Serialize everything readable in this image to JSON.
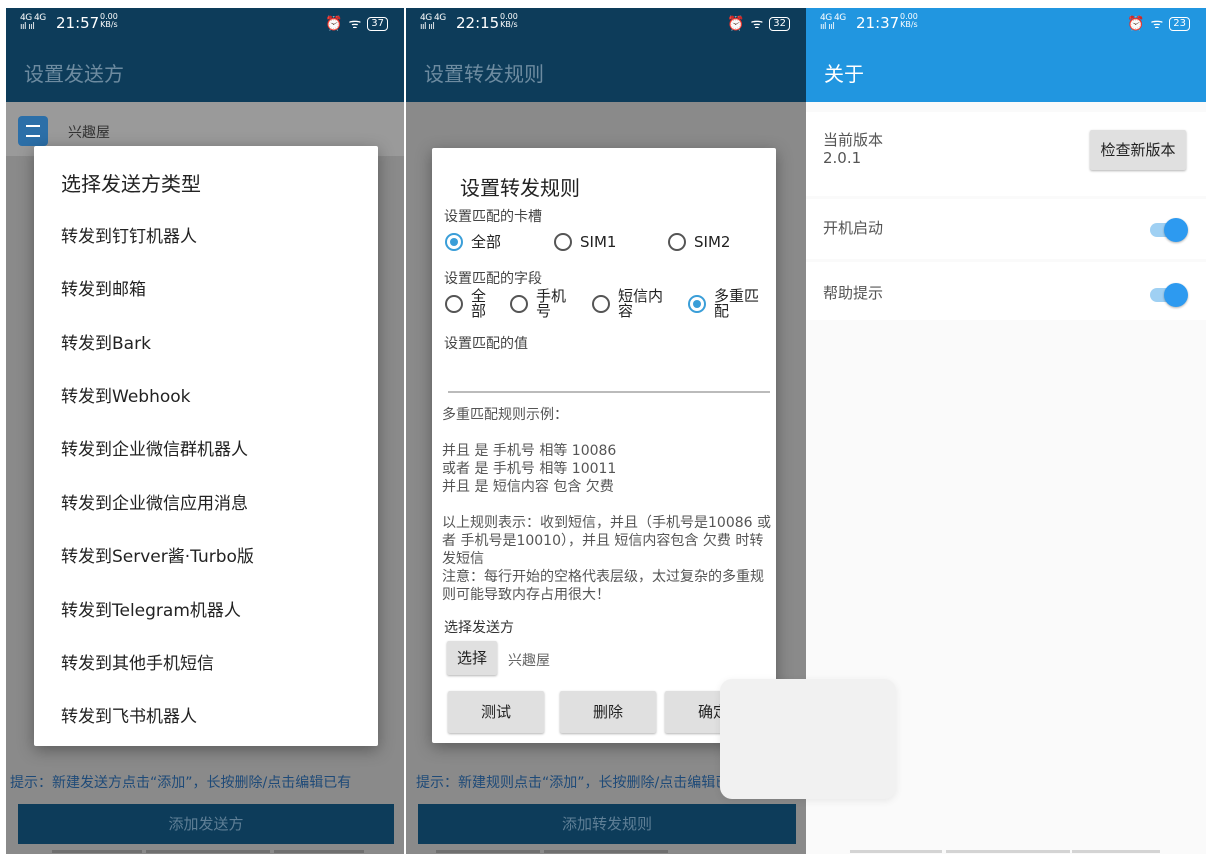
{
  "panel1": {
    "status": {
      "signal": "4G 4G",
      "time": "21:57",
      "speed": "0.00 KB/s",
      "alarm_icon": "alarm-clock-icon",
      "wifi_icon": "wifi-icon",
      "battery": "37"
    },
    "title": "设置发送方",
    "list_item": "兴趣屋",
    "dialog": {
      "title": "选择发送方类型",
      "options": [
        "转发到钉钉机器人",
        "转发到邮箱",
        "转发到Bark",
        "转发到Webhook",
        "转发到企业微信群机器人",
        "转发到企业微信应用消息",
        "转发到Server酱·Turbo版",
        "转发到Telegram机器人",
        "转发到其他手机短信",
        "转发到飞书机器人"
      ]
    },
    "hint": "提示：新建发送方点击“添加”，长按删除/点击编辑已有",
    "add_button": "添加发送方"
  },
  "panel2": {
    "status": {
      "signal": "4G 4G",
      "time": "22:15",
      "speed": "0.00 KB/s",
      "battery": "32"
    },
    "title": "设置转发规则",
    "dialog": {
      "title": "设置转发规则",
      "sim_label": "设置匹配的卡槽",
      "sim_options": [
        "全部",
        "SIM1",
        "SIM2"
      ],
      "sim_selected": "全部",
      "field_label": "设置匹配的字段",
      "field_options": [
        "全部",
        "手机号",
        "短信内容",
        "多重匹配"
      ],
      "field_selected": "多重匹配",
      "value_label": "设置匹配的值",
      "example_title": "多重匹配规则示例：",
      "example_rules": " 并且 是 手机号 相等 10086\n 或者 是 手机号 相等 10011\n 并且 是 短信内容 包含 欠费",
      "example_desc": " 以上规则表示：收到短信，并且（手机号是10086 或者 手机号是10010），并且 短信内容包含 欠费 时转发短信\n 注意：每行开始的空格代表层级，太过复杂的多重规则可能导致内存占用很大！",
      "sender_label": "选择发送方",
      "select_button": "选择",
      "sender_value": "兴趣屋",
      "test_button": "测试",
      "delete_button": "删除",
      "confirm_button": "确定"
    },
    "hint": "提示：新建规则点击“添加”，长按删除/点击编辑已有",
    "add_button": "添加转发规则"
  },
  "panel3": {
    "status": {
      "signal": "4G 4G",
      "time": "21:37",
      "speed": "0.00 KB/s",
      "battery": "23"
    },
    "title": "关于",
    "version_label": "当前版本",
    "version_value": "2.0.1",
    "check_button": "检查新版本",
    "autostart_label": "开机启动",
    "autostart_on": true,
    "help_label": "帮助提示",
    "help_on": true
  },
  "colors": {
    "dark_appbar": "#0d3c5a",
    "blue_appbar": "#2196e0",
    "accent": "#3a9ed8"
  }
}
